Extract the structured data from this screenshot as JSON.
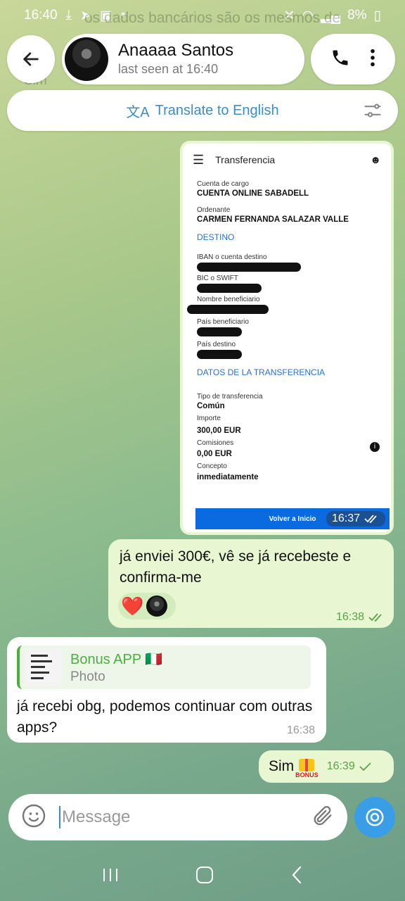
{
  "status_bar": {
    "time": "16:40",
    "battery": "8%"
  },
  "background_text": {
    "line1": "os dados bancários são os mesmos de",
    "line2": "Sim"
  },
  "header": {
    "contact_name": "Anaaaa Santos",
    "status": "last seen at 16:40"
  },
  "translate_bar": {
    "label": "Translate to English"
  },
  "photo_message": {
    "time": "16:37",
    "receipt": {
      "title": "Transferencia",
      "fields": [
        {
          "label": "Cuenta de cargo",
          "value": "CUENTA ONLINE SABADELL"
        },
        {
          "label": "Ordenante",
          "value": "CARMEN FERNANDA SALAZAR VALLE"
        }
      ],
      "destino_heading": "DESTINO",
      "hidden_fields": [
        "IBAN o cuenta destino",
        "BIC o SWIFT",
        "Nombre beneficiario",
        "País beneficiario",
        "País destino"
      ],
      "datos_heading": "DATOS DE LA TRANSFERENCIA",
      "details": [
        {
          "label": "Tipo de transferencia",
          "value": "Común"
        },
        {
          "label": "Importe",
          "value": "300,00 EUR"
        },
        {
          "label": "Comisiones",
          "value": "0,00 EUR"
        },
        {
          "label": "Concepto",
          "value": "inmediatamente"
        }
      ],
      "button": "Volver a Inicio"
    }
  },
  "messages": [
    {
      "direction": "out",
      "text": "já enviei 300€, vê se já recebeste e confirma-me",
      "time": "16:38",
      "reaction": "❤️"
    },
    {
      "direction": "in",
      "reply_to": {
        "title": "Bonus APP 🇮🇹",
        "subtitle": "Photo"
      },
      "text": "já recebi obg, podemos continuar com outras apps?",
      "time": "16:38"
    },
    {
      "direction": "out",
      "text": "Sim",
      "sticker_label": "BONUS",
      "time": "16:39"
    }
  ],
  "composer": {
    "placeholder": "Message"
  },
  "colors": {
    "accent": "#3a8ec7",
    "outgoing_bubble": "#e8f7d2",
    "check_green": "#5aa049",
    "reply_green": "#4cae40"
  }
}
